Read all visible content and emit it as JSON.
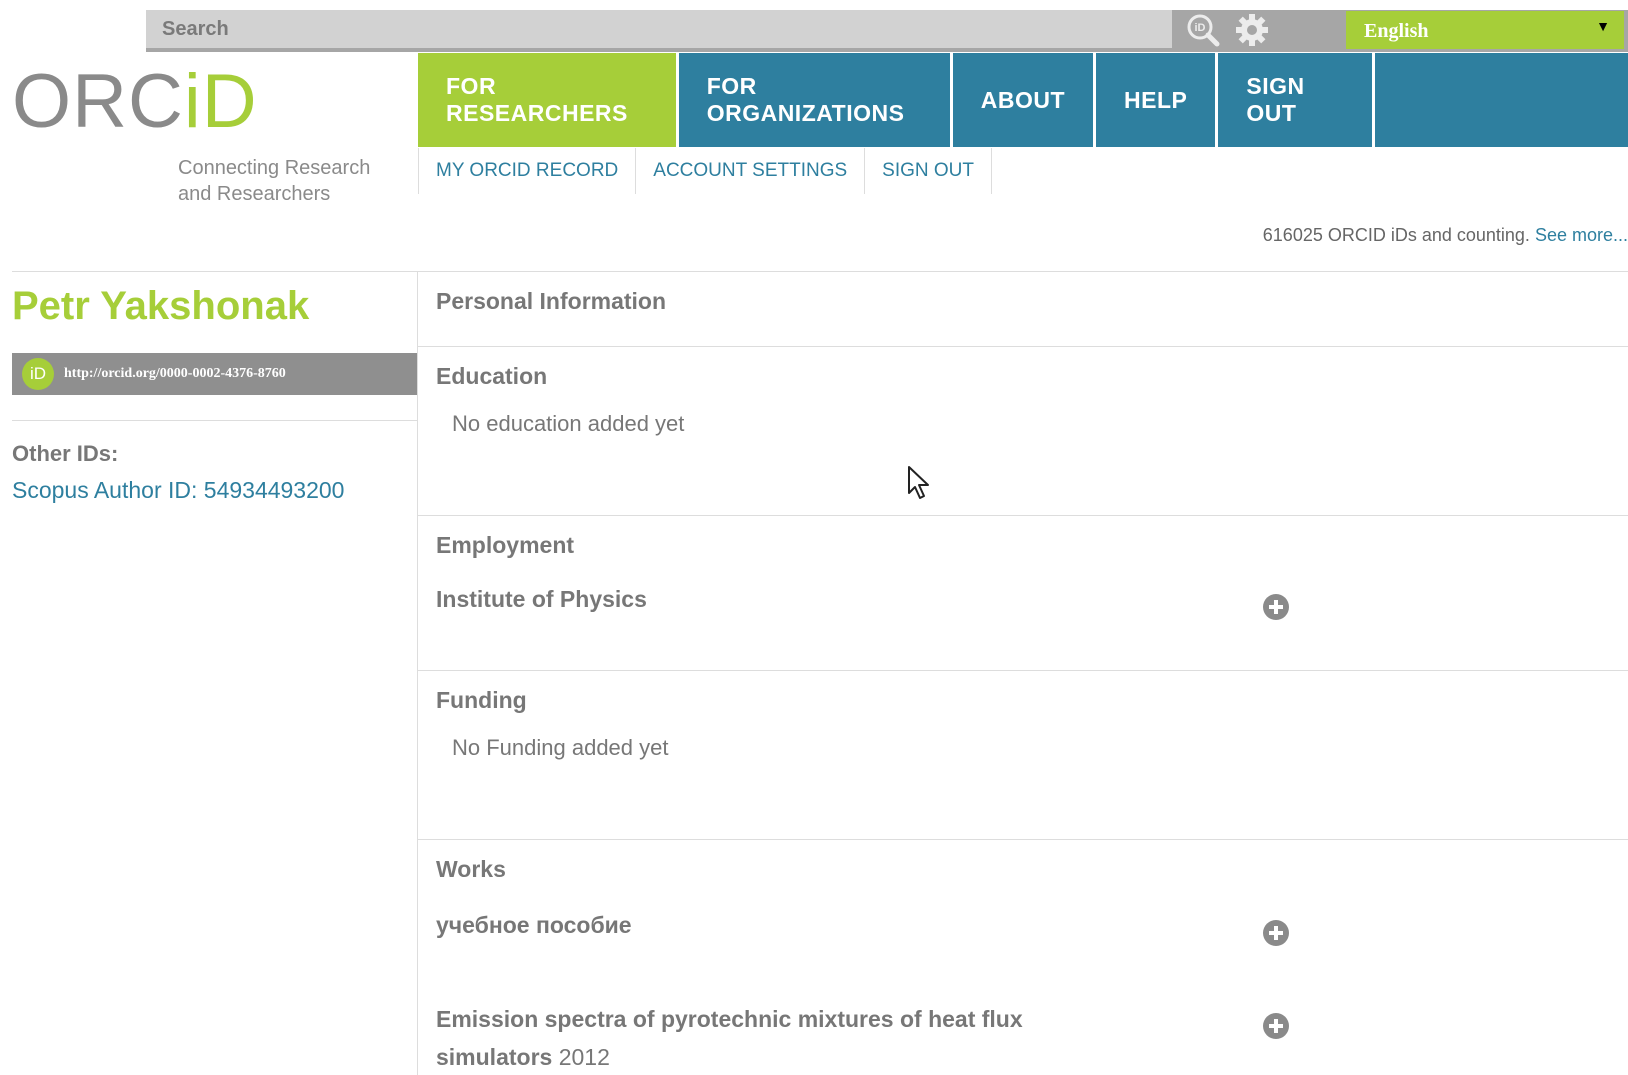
{
  "search": {
    "placeholder": "Search"
  },
  "language": {
    "selected": "English"
  },
  "logo": {
    "text_main": "ORC",
    "text_id": "iD",
    "tagline": "Connecting Research and Researchers"
  },
  "main_nav": [
    {
      "label": "FOR RESEARCHERS",
      "active": true
    },
    {
      "label": "FOR ORGANIZATIONS",
      "active": false
    },
    {
      "label": "ABOUT",
      "active": false
    },
    {
      "label": "HELP",
      "active": false
    },
    {
      "label": "SIGN OUT",
      "active": false
    }
  ],
  "sub_nav": [
    {
      "label": "MY ORCID RECORD"
    },
    {
      "label": "ACCOUNT SETTINGS"
    },
    {
      "label": "SIGN OUT"
    }
  ],
  "counter": {
    "text": "616025 ORCID iDs and counting.",
    "link": "See more..."
  },
  "profile": {
    "name": "Petr Yakshonak",
    "badge": "iD",
    "orcid_url": "http://orcid.org/0000-0002-4376-8760",
    "other_ids_label": "Other IDs:",
    "scopus": "Scopus Author ID: 54934493200"
  },
  "sections": {
    "personal": {
      "title": "Personal Information"
    },
    "education": {
      "title": "Education",
      "empty": "No education added yet"
    },
    "employment": {
      "title": "Employment",
      "entries": [
        {
          "title": "Institute of Physics"
        }
      ]
    },
    "funding": {
      "title": "Funding",
      "empty": "No Funding added yet"
    },
    "works": {
      "title": "Works",
      "entries": [
        {
          "title": "учебное пособие",
          "year": ""
        },
        {
          "title": "Emission spectra of pyrotechnic mixtures of heat flux simulators",
          "year": "2012"
        }
      ]
    }
  },
  "colors": {
    "brand_green": "#a6ce39",
    "brand_blue": "#2e7f9f",
    "text_gray": "#777777"
  },
  "icons": [
    "search-icon",
    "gear-icon",
    "plus-circle-icon",
    "orcid-id-icon",
    "cursor-icon"
  ]
}
